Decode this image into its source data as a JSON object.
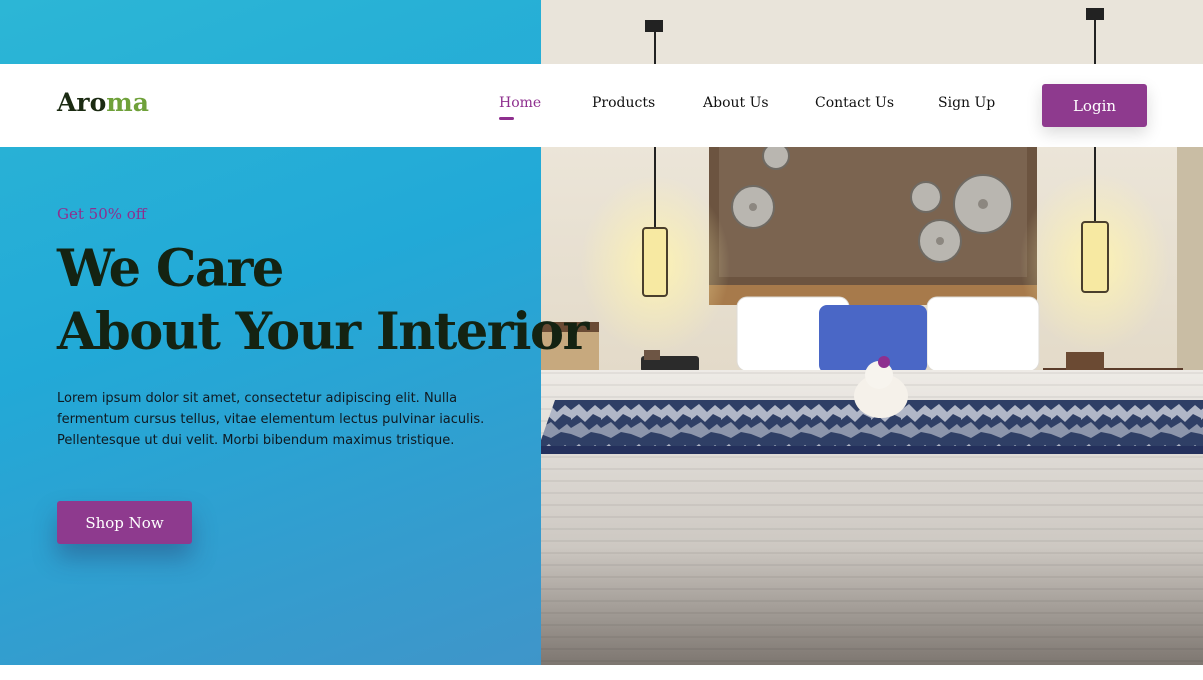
{
  "brand": {
    "logo_part1": "Aro",
    "logo_part2": "ma"
  },
  "nav": {
    "items": [
      {
        "label": "Home",
        "active": true
      },
      {
        "label": "Products",
        "active": false
      },
      {
        "label": "About Us",
        "active": false
      },
      {
        "label": "Contact Us",
        "active": false
      },
      {
        "label": "Sign Up",
        "active": false
      }
    ],
    "login_label": "Login"
  },
  "hero": {
    "discount": "Get 50% off",
    "headline_line1": "We Care",
    "headline_line2": "About Your Interior",
    "description": "Lorem ipsum dolor sit amet, consectetur adipiscing elit. Nulla fermentum cursus tellus, vitae elementum lectus pulvinar iaculis. Pellentesque ut dui velit. Morbi bibendum maximus tristique.",
    "cta_label": "Shop Now",
    "image_subject": "hotel bedroom with headboard, lamps and wall plates"
  },
  "colors": {
    "accent": "#8e3a8e",
    "logo_green": "#6fa13a",
    "hero_blue": "#22a9d7",
    "headline": "#142312"
  }
}
